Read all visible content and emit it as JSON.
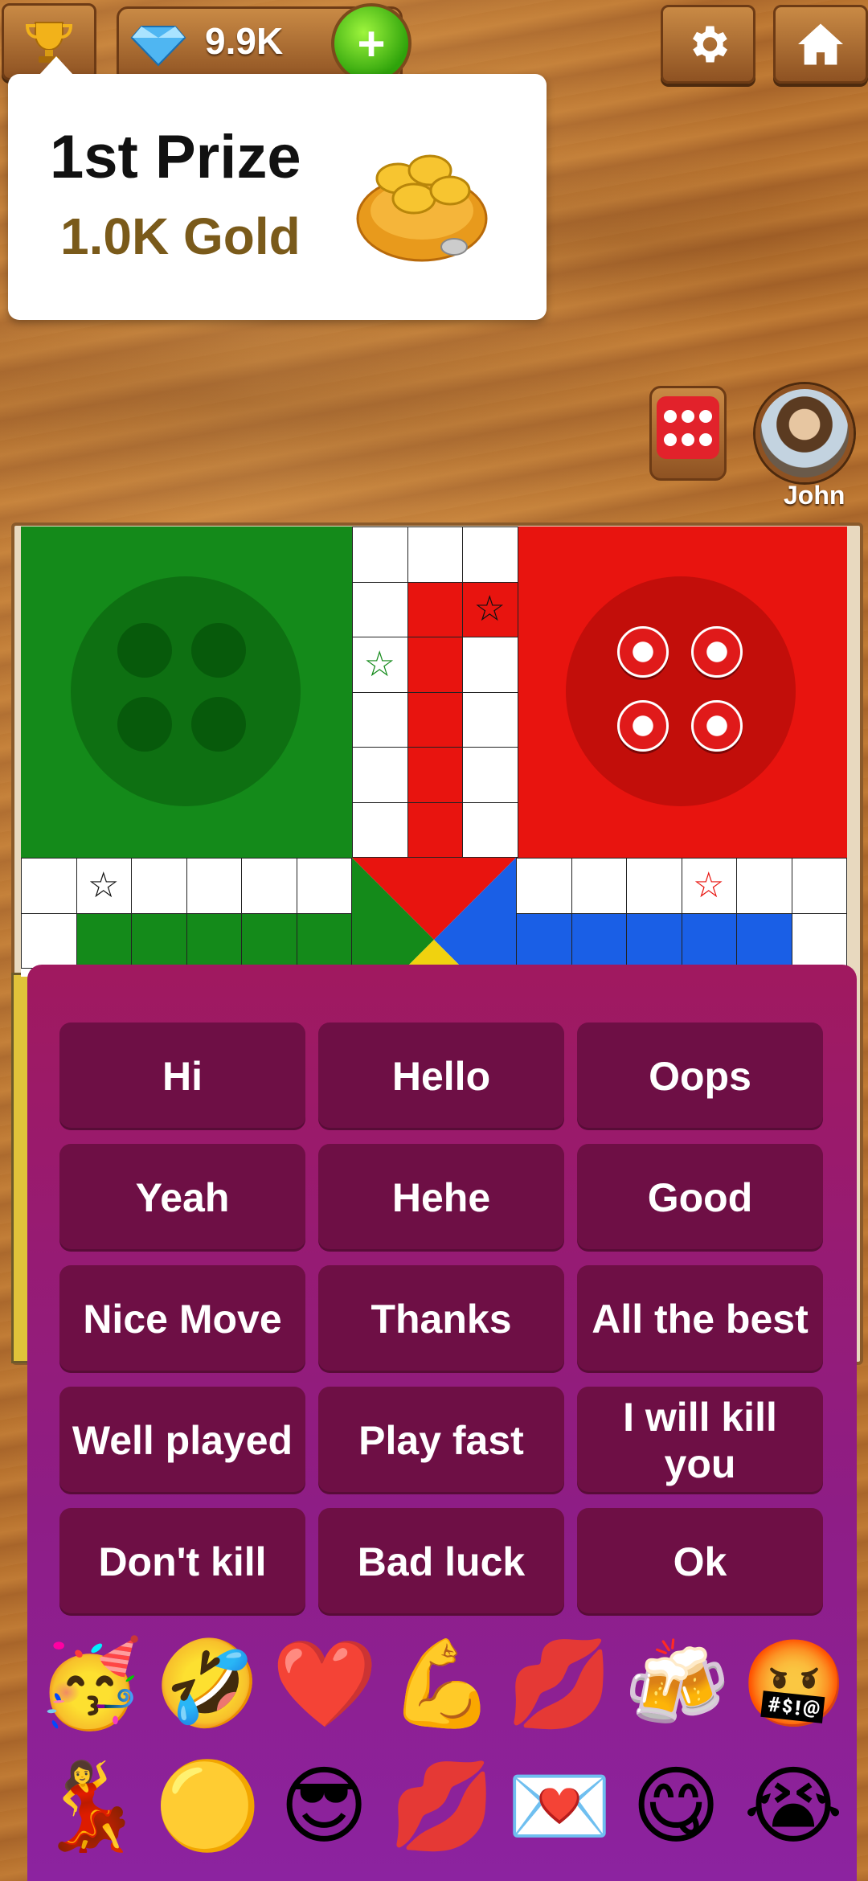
{
  "topbar": {
    "trophy_icon": "trophy-icon",
    "gem_icon": "diamond-icon",
    "gem_count": "9.9K",
    "add_label": "+",
    "settings_icon": "gear-icon",
    "home_icon": "home-icon"
  },
  "prize": {
    "title": "1st Prize",
    "amount": "1.0K Gold",
    "icon": "gold-coin-bag-icon"
  },
  "player": {
    "name": "John",
    "dice_value": 6,
    "dice_color": "#e2222b"
  },
  "board": {
    "colors": {
      "green": "#148a1a",
      "red": "#e8140f",
      "blue": "#1a5fe6",
      "yellow": "#f0d20f"
    },
    "red_tokens_home": 4,
    "green_tokens_home": 0
  },
  "chat": {
    "messages": [
      "Hi",
      "Hello",
      "Oops",
      "Yeah",
      "Hehe",
      "Good",
      "Nice Move",
      "Thanks",
      "All the best",
      "Well played",
      "Play fast",
      "I will kill you",
      "Don't kill",
      "Bad luck",
      "Ok"
    ],
    "emojis": [
      {
        "name": "party-face-emoji",
        "glyph": "🥳"
      },
      {
        "name": "rolling-laughing-emoji",
        "glyph": "🤣"
      },
      {
        "name": "red-heart-emoji",
        "glyph": "❤️"
      },
      {
        "name": "flexed-biceps-emoji",
        "glyph": "💪"
      },
      {
        "name": "kiss-lips-emoji",
        "glyph": "💋"
      },
      {
        "name": "clinking-beer-emoji",
        "glyph": "🍻"
      },
      {
        "name": "cursing-face-emoji",
        "glyph": "🤬"
      },
      {
        "name": "dancer-emoji",
        "glyph": "💃"
      },
      {
        "name": "yellow-circle-emoji",
        "glyph": "🟡"
      },
      {
        "name": "sunglasses-face-emoji",
        "glyph": "😎"
      },
      {
        "name": "lips-emoji",
        "glyph": "💋"
      },
      {
        "name": "love-letter-emoji",
        "glyph": "💌"
      },
      {
        "name": "yum-face-emoji",
        "glyph": "😋"
      },
      {
        "name": "crying-face-emoji",
        "glyph": "😭"
      }
    ]
  }
}
